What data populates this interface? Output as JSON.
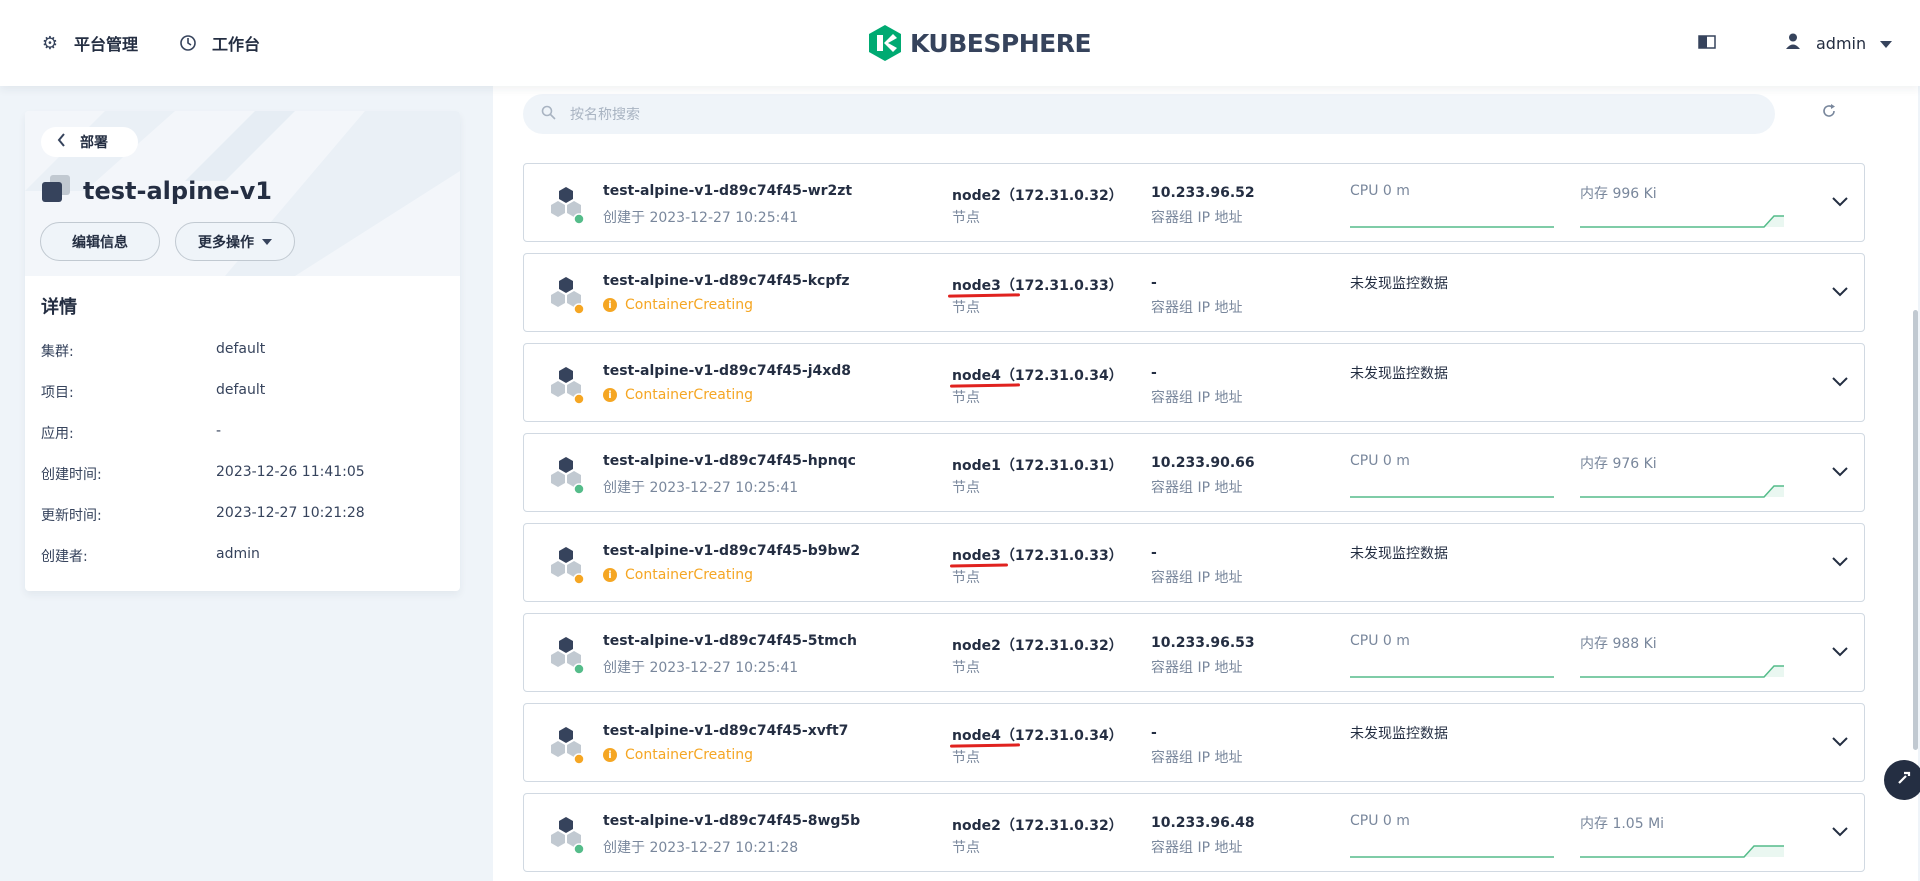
{
  "header": {
    "platform_label": "平台管理",
    "workbench_label": "工作台",
    "logo_text": "KUBESPHERE",
    "user": "admin"
  },
  "sidebar": {
    "back_label": "部署",
    "resource_name": "test-alpine-v1",
    "edit_label": "编辑信息",
    "more_label": "更多操作",
    "details_title": "详情",
    "details": [
      {
        "key": "集群:",
        "value": "default"
      },
      {
        "key": "项目:",
        "value": "default"
      },
      {
        "key": "应用:",
        "value": "-"
      },
      {
        "key": "创建时间:",
        "value": "2023-12-26 11:41:05"
      },
      {
        "key": "更新时间:",
        "value": "2023-12-27 10:21:28"
      },
      {
        "key": "创建者:",
        "value": "admin"
      }
    ]
  },
  "search": {
    "placeholder": "按名称搜索"
  },
  "pods": [
    {
      "name": "test-alpine-v1-d89c74f45-wr2zt",
      "sub": "创建于 2023-12-27 10:25:41",
      "status": "running",
      "node": "node2（172.31.0.32）",
      "node_label": "节点",
      "ip": "10.233.96.52",
      "ip_label": "容器组 IP 地址",
      "cpu": "CPU 0 m",
      "mem": "内存 996 Ki",
      "underline": false
    },
    {
      "name": "test-alpine-v1-d89c74f45-kcpfz",
      "sub": "ContainerCreating",
      "status": "creating",
      "node": "node3（172.31.0.33）",
      "node_label": "节点",
      "ip": "-",
      "ip_label": "容器组 IP 地址",
      "nomon": "未发现监控数据",
      "underline": true
    },
    {
      "name": "test-alpine-v1-d89c74f45-j4xd8",
      "sub": "ContainerCreating",
      "status": "creating",
      "node": "node4（172.31.0.34）",
      "node_label": "节点",
      "ip": "-",
      "ip_label": "容器组 IP 地址",
      "nomon": "未发现监控数据",
      "underline": true
    },
    {
      "name": "test-alpine-v1-d89c74f45-hpnqc",
      "sub": "创建于 2023-12-27 10:25:41",
      "status": "running",
      "node": "node1（172.31.0.31）",
      "node_label": "节点",
      "ip": "10.233.90.66",
      "ip_label": "容器组 IP 地址",
      "cpu": "CPU 0 m",
      "mem": "内存 976 Ki",
      "underline": false
    },
    {
      "name": "test-alpine-v1-d89c74f45-b9bw2",
      "sub": "ContainerCreating",
      "status": "creating",
      "node": "node3（172.31.0.33）",
      "node_label": "节点",
      "ip": "-",
      "ip_label": "容器组 IP 地址",
      "nomon": "未发现监控数据",
      "underline": true
    },
    {
      "name": "test-alpine-v1-d89c74f45-5tmch",
      "sub": "创建于 2023-12-27 10:25:41",
      "status": "running",
      "node": "node2（172.31.0.32）",
      "node_label": "节点",
      "ip": "10.233.96.53",
      "ip_label": "容器组 IP 地址",
      "cpu": "CPU 0 m",
      "mem": "内存 988 Ki",
      "underline": false
    },
    {
      "name": "test-alpine-v1-d89c74f45-xvft7",
      "sub": "ContainerCreating",
      "status": "creating",
      "node": "node4（172.31.0.34）",
      "node_label": "节点",
      "ip": "-",
      "ip_label": "容器组 IP 地址",
      "nomon": "未发现监控数据",
      "underline": true
    },
    {
      "name": "test-alpine-v1-d89c74f45-8wg5b",
      "sub": "创建于 2023-12-27 10:21:28",
      "status": "running",
      "node": "node2（172.31.0.32）",
      "node_label": "节点",
      "ip": "10.233.96.48",
      "ip_label": "容器组 IP 地址",
      "cpu": "CPU 0 m",
      "mem": "内存 1.05 Mi",
      "underline": false
    }
  ],
  "colors": {
    "running": "#55bc8a",
    "creating": "#f5a623",
    "annotation": "#e0221f",
    "brand": "#00aa72"
  }
}
